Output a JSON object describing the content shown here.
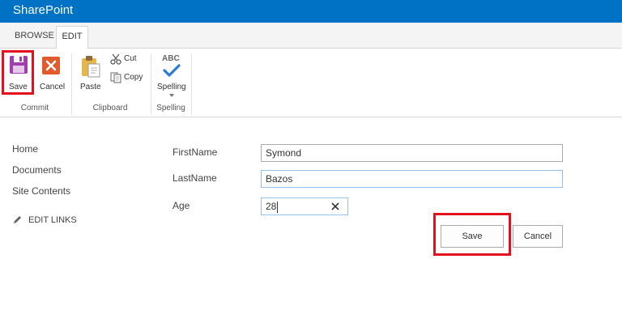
{
  "app": {
    "title": "SharePoint"
  },
  "tabs": [
    {
      "label": "BROWSE"
    },
    {
      "label": "EDIT"
    }
  ],
  "ribbon": {
    "commit": {
      "group_label": "Commit",
      "save_label": "Save",
      "cancel_label": "Cancel"
    },
    "clipboard": {
      "group_label": "Clipboard",
      "paste_label": "Paste",
      "cut_label": "Cut",
      "copy_label": "Copy"
    },
    "spelling": {
      "group_label": "Spelling",
      "button_label": "Spelling",
      "abc_text": "ABC"
    }
  },
  "nav": {
    "items": [
      {
        "label": "Home"
      },
      {
        "label": "Documents"
      },
      {
        "label": "Site Contents"
      }
    ],
    "edit_links": "EDIT LINKS"
  },
  "form": {
    "first_name": {
      "label": "FirstName",
      "value": "Symond"
    },
    "last_name": {
      "label": "LastName",
      "value": "Bazos"
    },
    "age": {
      "label": "Age",
      "value": "28"
    },
    "save_label": "Save",
    "cancel_label": "Cancel"
  },
  "colors": {
    "suite_bar": "#0072c6",
    "highlight": "#e3101e"
  }
}
